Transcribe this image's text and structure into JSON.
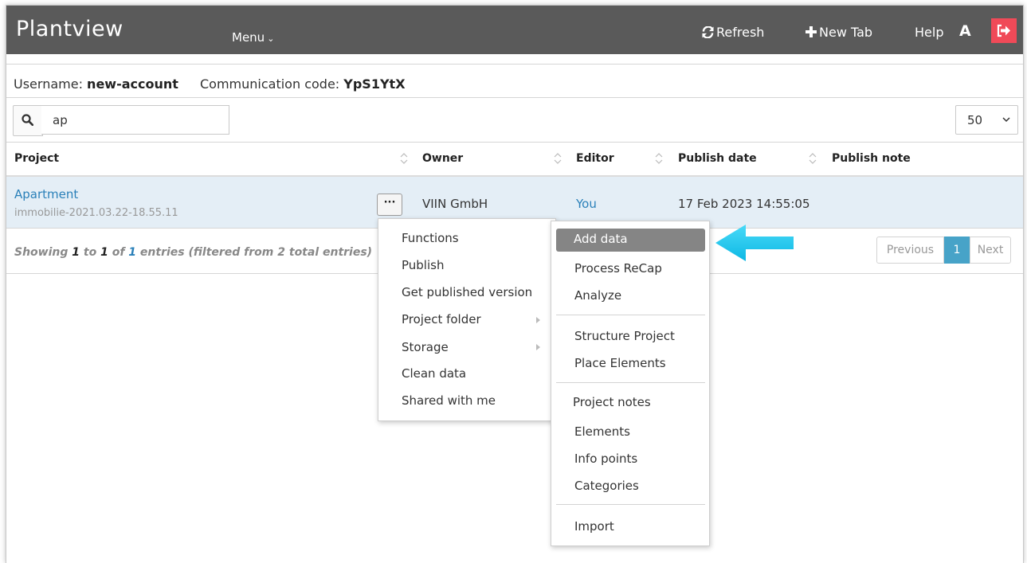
{
  "header": {
    "brand": "Plantview",
    "menu_label": "Menu",
    "refresh_label": "Refresh",
    "new_tab_label": "New Tab",
    "help_label": "Help",
    "avatar_letter": "A"
  },
  "user": {
    "username_label": "Username:",
    "username": "new-account",
    "comm_label": "Communication code:",
    "comm_code": "YpS1YtX"
  },
  "search": {
    "value": "ap"
  },
  "page_size": {
    "selected": "50"
  },
  "table": {
    "columns": [
      "Project",
      "Owner",
      "Editor",
      "Publish date",
      "Publish note"
    ],
    "rows": [
      {
        "project": "Apartment",
        "project_id": "immobilie-2021.03.22-18.55.11",
        "actions": "···",
        "owner": "VIIN GmbH",
        "editor": "You",
        "publish_date": "17 Feb 2023 14:55:05",
        "publish_note": ""
      }
    ]
  },
  "info": {
    "prefix": "Showing ",
    "from": "1",
    "to_word": " to ",
    "to": "1",
    "of_word": " of ",
    "total": "1",
    "suffix": " entries (filtered from 2 total entries)"
  },
  "pagination": {
    "previous": "Previous",
    "current": "1",
    "next": "Next"
  },
  "context_menu": {
    "items": [
      "Functions",
      "Publish",
      "Get published version",
      "Project folder",
      "Storage",
      "Clean data",
      "Shared with me"
    ]
  },
  "submenu": {
    "items": [
      "Add data",
      "Process ReCap",
      "Analyze",
      "Structure Project",
      "Place Elements",
      "Project notes",
      "Elements",
      "Info points",
      "Categories",
      "Import"
    ],
    "highlighted": "Add data"
  },
  "colors": {
    "topbar": "#5a5a5a",
    "logout": "#f04a58",
    "link": "#2a80b9",
    "row_highlight": "#e4eef6",
    "pager_active": "#47a3c8",
    "menu_highlight": "#858585",
    "annotation_arrow": "#1ec8ee"
  }
}
